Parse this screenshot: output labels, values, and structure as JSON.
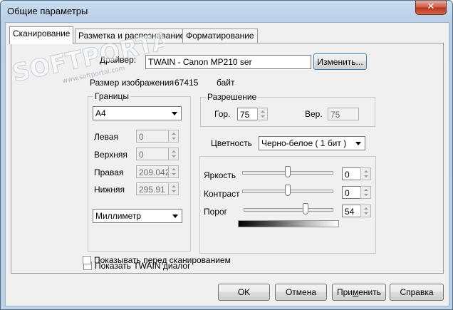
{
  "window": {
    "title": "Общие параметры",
    "close_symbol": "✕"
  },
  "tabs": [
    {
      "label": "Сканирование",
      "active": true
    },
    {
      "label": "Разметка и распознавание",
      "active": false
    },
    {
      "label": "Форматирование",
      "active": false
    }
  ],
  "watermark": {
    "brand": "SOFTPORTAL",
    "url": "www.softportal.com"
  },
  "driver": {
    "label": "Драйвер:",
    "value": "TWAIN - Canon MP210 ser",
    "change_button": "Изменить..."
  },
  "image_size": {
    "label": "Размер изображения",
    "value": "67415",
    "unit": "байт"
  },
  "bounds": {
    "title": "Границы",
    "page_format": "A4",
    "left": {
      "label": "Левая",
      "value": "0"
    },
    "top": {
      "label": "Верхняя",
      "value": "0"
    },
    "right": {
      "label": "Правая",
      "value": "209.042"
    },
    "bottom": {
      "label": "Нижняя",
      "value": "295.91"
    },
    "units": "Миллиметр"
  },
  "resolution": {
    "title": "Разрешение",
    "horizontal": {
      "label": "Гор.",
      "value": "75"
    },
    "vertical": {
      "label": "Вер.",
      "value": "75"
    }
  },
  "color": {
    "label": "Цветность",
    "value": "Черно-белое ( 1 бит )"
  },
  "adjustments": {
    "brightness": {
      "label": "Яркость",
      "value": "0",
      "level": 0.5
    },
    "contrast": {
      "label": "Контраст",
      "value": "0",
      "level": 0.5
    },
    "threshold": {
      "label": "Порог",
      "value": "54",
      "level": 0.7
    }
  },
  "options": {
    "show_twain": {
      "label": "Показать TWAIN диалог",
      "checked": false
    },
    "show_before_scan": {
      "label": "Показывать перед сканированием",
      "checked": false
    }
  },
  "buttons": {
    "ok": "OK",
    "cancel": "Отмена",
    "apply_pre": "При",
    "apply_hotkey": "м",
    "apply_post": "енить",
    "help": "Справка"
  }
}
